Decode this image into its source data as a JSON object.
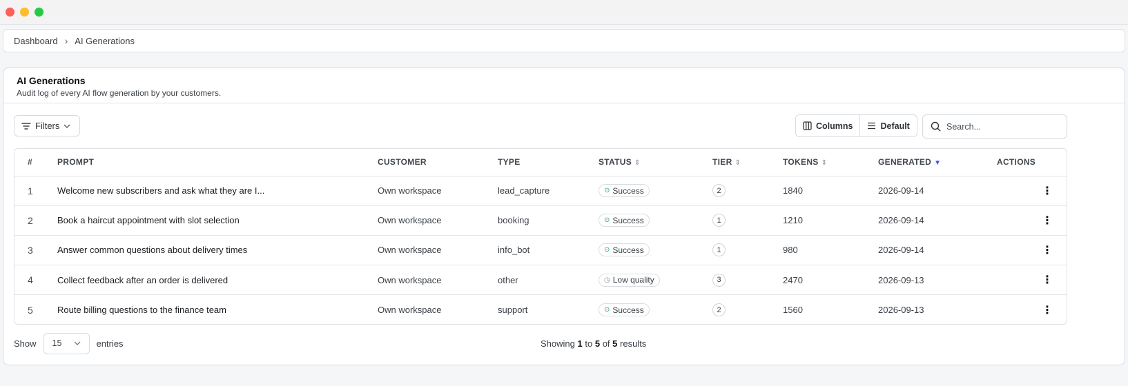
{
  "breadcrumb": {
    "root": "Dashboard",
    "current": "AI Generations"
  },
  "header": {
    "title": "AI Generations",
    "subtitle": "Audit log of every AI flow generation by your customers."
  },
  "toolbar": {
    "filters_label": "Filters",
    "columns_label": "Columns",
    "density_label": "Default",
    "search_placeholder": "Search..."
  },
  "table": {
    "columns": [
      "#",
      "PROMPT",
      "CUSTOMER",
      "TYPE",
      "STATUS",
      "TIER",
      "TOKENS",
      "GENERATED",
      "ACTIONS"
    ],
    "rows": [
      {
        "num": "1",
        "prompt": "Welcome new subscribers and ask what they are I...",
        "customer": "Own workspace",
        "type": "lead_capture",
        "status": "Success",
        "tier": "2",
        "tokens": "1840",
        "generated": "2026-09-14"
      },
      {
        "num": "2",
        "prompt": "Book a haircut appointment with slot selection",
        "customer": "Own workspace",
        "type": "booking",
        "status": "Success",
        "tier": "1",
        "tokens": "1210",
        "generated": "2026-09-14"
      },
      {
        "num": "3",
        "prompt": "Answer common questions about delivery times",
        "customer": "Own workspace",
        "type": "info_bot",
        "status": "Success",
        "tier": "1",
        "tokens": "980",
        "generated": "2026-09-14"
      },
      {
        "num": "4",
        "prompt": "Collect feedback after an order is delivered",
        "customer": "Own workspace",
        "type": "other",
        "status": "Low quality",
        "tier": "3",
        "tokens": "2470",
        "generated": "2026-09-13"
      },
      {
        "num": "5",
        "prompt": "Route billing questions to the finance team",
        "customer": "Own workspace",
        "type": "support",
        "status": "Success",
        "tier": "2",
        "tokens": "1560",
        "generated": "2026-09-13"
      }
    ]
  },
  "footer": {
    "show_label": "Show",
    "page_size": "15",
    "entries_label": "entries",
    "showing_label": "Showing",
    "from": "1",
    "to_label": "to",
    "to": "5",
    "of_label": "of",
    "total": "5",
    "results_label": "results"
  }
}
